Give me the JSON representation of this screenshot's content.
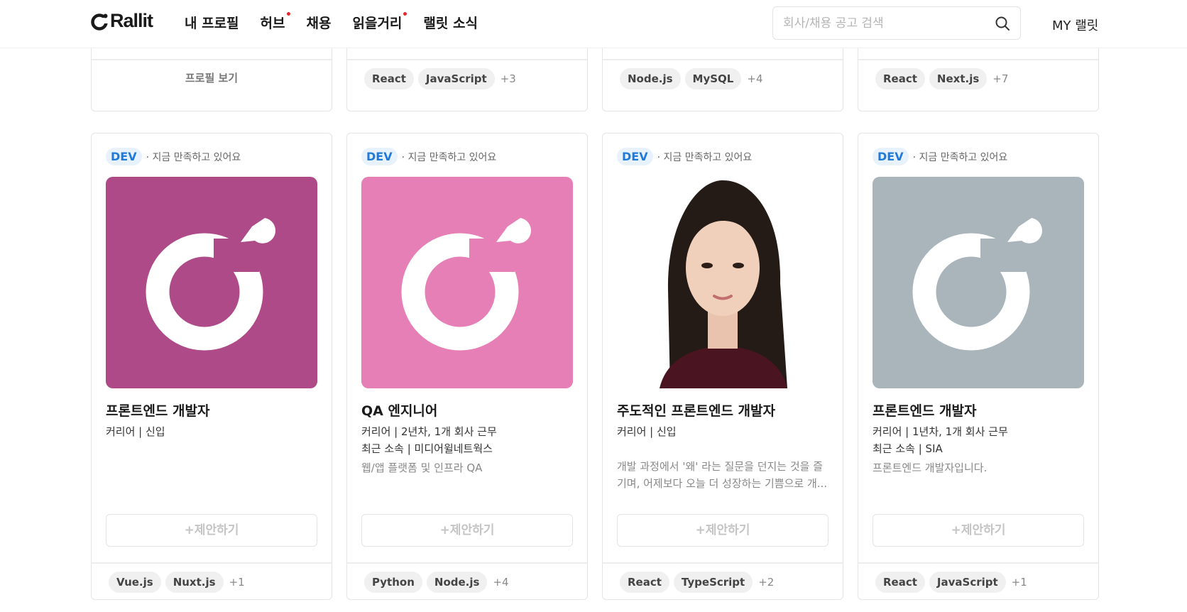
{
  "header": {
    "logo_text": "Rallit",
    "nav": [
      {
        "label": "내 프로필",
        "dot": false
      },
      {
        "label": "허브",
        "dot": true
      },
      {
        "label": "채용",
        "dot": false
      },
      {
        "label": "읽을거리",
        "dot": true
      },
      {
        "label": "랠릿 소식",
        "dot": false
      }
    ],
    "search_placeholder": "회사/채용 공고 검색",
    "my_label": "MY 랠릿"
  },
  "top_row": [
    {
      "profile_link": "프로필 보기",
      "tags": [],
      "more": ""
    },
    {
      "profile_link": "",
      "tags": [
        "React",
        "JavaScript"
      ],
      "more": "+3"
    },
    {
      "profile_link": "",
      "tags": [
        "Node.js",
        "MySQL"
      ],
      "more": "+4"
    },
    {
      "profile_link": "",
      "tags": [
        "React",
        "Next.js"
      ],
      "more": "+7"
    }
  ],
  "cards": [
    {
      "badge": "DEV",
      "status": "· 지금 만족하고 있어요",
      "avatar": {
        "type": "logo",
        "bg": "#AE4A87"
      },
      "title": "프론트엔드 개발자",
      "career": "커리어 | 신입",
      "company": "",
      "intro": "",
      "propose": "+제안하기",
      "tags": [
        "Vue.js",
        "Nuxt.js"
      ],
      "more": "+1"
    },
    {
      "badge": "DEV",
      "status": "· 지금 만족하고 있어요",
      "avatar": {
        "type": "logo",
        "bg": "#E67FB5"
      },
      "title": "QA 엔지니어",
      "career": "커리어 | 2년차, 1개 회사 근무",
      "company": "최근 소속 | 미디어윌네트웍스",
      "intro": "웹/앱 플랫폼 및 인프라 QA",
      "propose": "+제안하기",
      "tags": [
        "Python",
        "Node.js"
      ],
      "more": "+4"
    },
    {
      "badge": "DEV",
      "status": "· 지금 만족하고 있어요",
      "avatar": {
        "type": "photo",
        "bg": "#ffffff"
      },
      "title": "주도적인 프론트엔드 개발자",
      "career": "커리어 | 신입",
      "company": "",
      "intro": "개발 과정에서 '왜' 라는 질문을 던지는 것을 즐기며, 어제보다 오늘 더 성장하는 기쁨으로 개...",
      "propose": "+제안하기",
      "tags": [
        "React",
        "TypeScript"
      ],
      "more": "+2"
    },
    {
      "badge": "DEV",
      "status": "· 지금 만족하고 있어요",
      "avatar": {
        "type": "logo",
        "bg": "#A9B5BB"
      },
      "title": "프론트엔드 개발자",
      "career": "커리어 | 1년차, 1개 회사 근무",
      "company": "최근 소속 | SIA",
      "intro": "프론트엔드 개발자입니다.",
      "propose": "+제안하기",
      "tags": [
        "React",
        "JavaScript"
      ],
      "more": "+1"
    }
  ]
}
